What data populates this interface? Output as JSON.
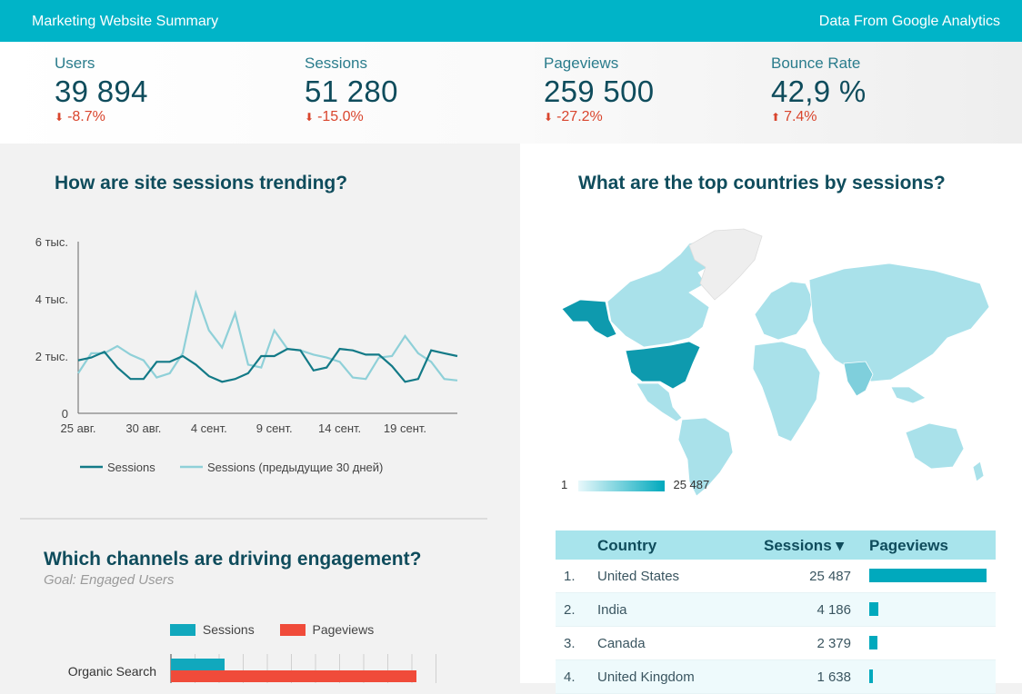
{
  "header": {
    "title": "Marketing Website Summary",
    "source": "Data From Google Analytics"
  },
  "kpis": [
    {
      "label": "Users",
      "value": "39 894",
      "arrow": "⬇",
      "change": "-8.7%"
    },
    {
      "label": "Sessions",
      "value": "51 280",
      "arrow": "⬇",
      "change": "-15.0%"
    },
    {
      "label": "Pageviews",
      "value": "259 500",
      "arrow": "⬇",
      "change": "-27.2%"
    },
    {
      "label": "Bounce Rate",
      "value": "42,9 %",
      "arrow": "⬆",
      "change": "7.4%"
    }
  ],
  "trend": {
    "title": "How are site sessions trending?",
    "chart_data": {
      "type": "line",
      "y_ticks": [
        "6 тыс.",
        "4 тыс.",
        "2 тыс.",
        "0"
      ],
      "x_ticks": [
        "25 авг.",
        "30 авг.",
        "4 сент.",
        "9 сент.",
        "14 сент.",
        "19 сент."
      ],
      "ylim": [
        0,
        6000
      ],
      "x": [
        1,
        2,
        3,
        4,
        5,
        6,
        7,
        8,
        9,
        10,
        11,
        12,
        13,
        14,
        15,
        16,
        17,
        18,
        19,
        20,
        21,
        22,
        23,
        24,
        25,
        26,
        27,
        28,
        29,
        30
      ],
      "series": [
        {
          "name": "Sessions",
          "color": "#137a87",
          "values": [
            1850,
            1950,
            2150,
            1600,
            1200,
            1200,
            1800,
            1800,
            2000,
            1700,
            1300,
            1100,
            1200,
            1400,
            2000,
            2000,
            2250,
            2200,
            1500,
            1600,
            2250,
            2200,
            2050,
            2050,
            1650,
            1100,
            1200,
            2200,
            2100,
            2000
          ]
        },
        {
          "name": "Sessions (предыдущие 30 дней)",
          "color": "#8fd0d8",
          "values": [
            1400,
            2100,
            2100,
            2350,
            2050,
            1850,
            1250,
            1400,
            2100,
            4200,
            2900,
            2300,
            3500,
            1700,
            1600,
            2900,
            2250,
            2200,
            2050,
            1950,
            1800,
            1250,
            1200,
            1950,
            2000,
            2700,
            2100,
            1800,
            1200,
            1150
          ]
        }
      ]
    }
  },
  "countries": {
    "title": "What are the top countries by sessions?",
    "legend_min": "1",
    "legend_max": "25 487",
    "table_headers": {
      "country": "Country",
      "sessions": "Sessions ▾",
      "pageviews": "Pageviews"
    },
    "rows": [
      {
        "rank": "1.",
        "country": "United States",
        "sessions": "25 487",
        "pageviews_fraction": 1.0
      },
      {
        "rank": "2.",
        "country": "India",
        "sessions": "4 186",
        "pageviews_fraction": 0.08
      },
      {
        "rank": "3.",
        "country": "Canada",
        "sessions": "2 379",
        "pageviews_fraction": 0.07
      },
      {
        "rank": "4.",
        "country": "United Kingdom",
        "sessions": "1 638",
        "pageviews_fraction": 0.03
      }
    ]
  },
  "channels": {
    "title": "Which channels are driving engagement?",
    "subtitle": "Goal: Engaged Users",
    "legend": [
      {
        "label": "Sessions",
        "color": "#11a8bd"
      },
      {
        "label": "Pageviews",
        "color": "#f04b3a"
      }
    ],
    "chart_data": {
      "type": "bar",
      "categories": [
        "Organic Search"
      ],
      "series": [
        {
          "name": "Sessions",
          "values_fraction": [
            0.22
          ]
        },
        {
          "name": "Pageviews",
          "values_fraction": [
            1.0
          ]
        }
      ]
    }
  }
}
